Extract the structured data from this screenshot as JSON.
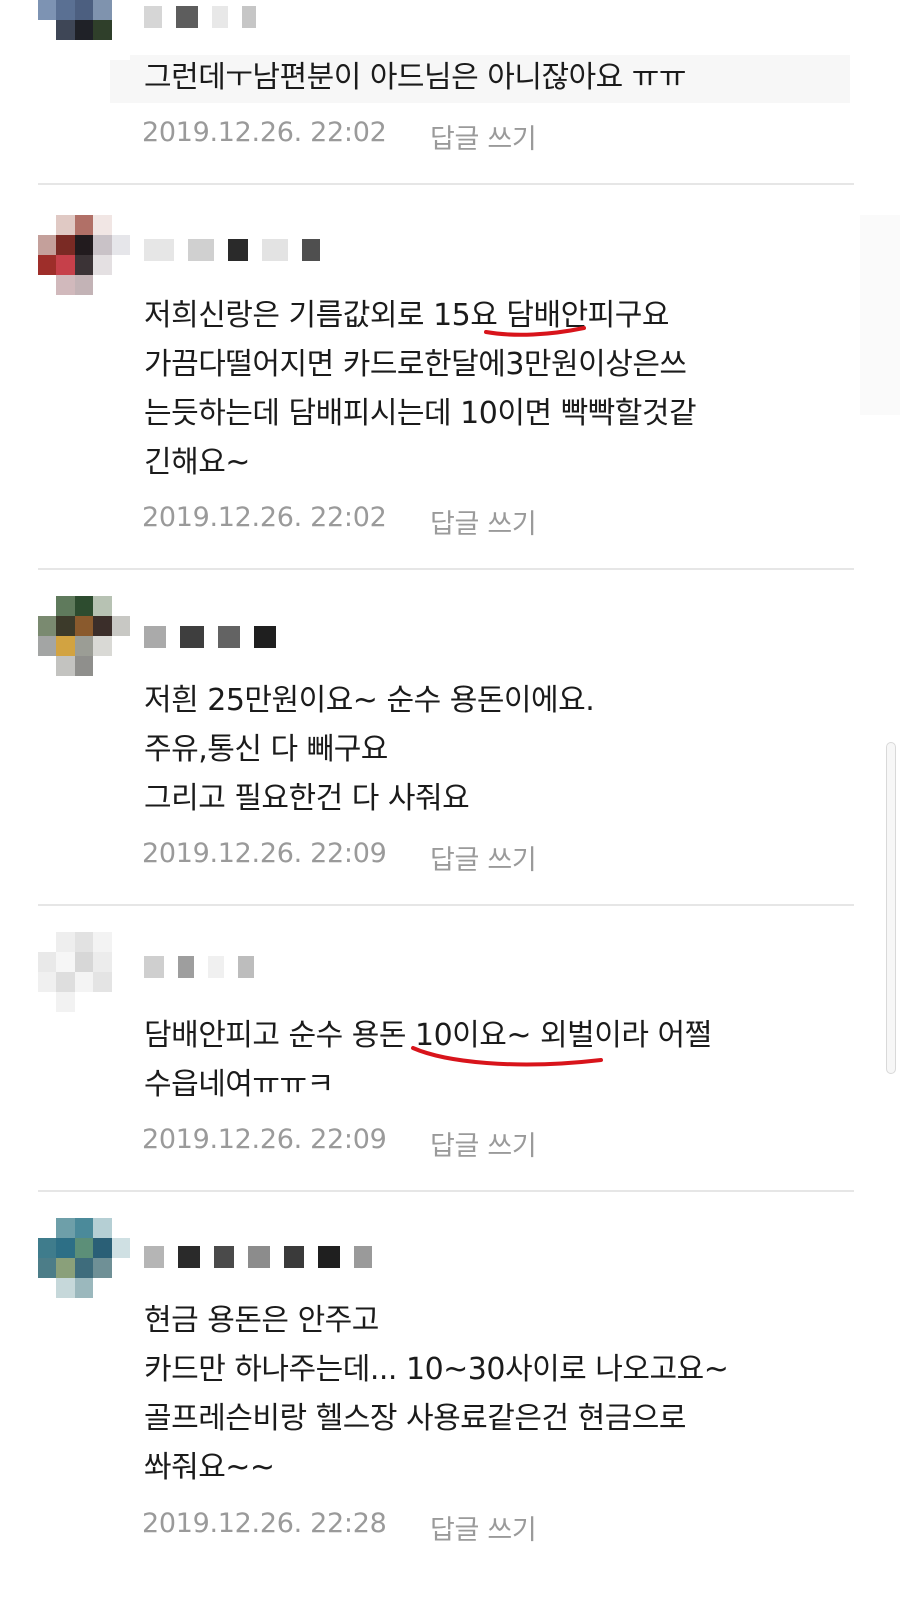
{
  "comments": [
    {
      "text_lines": [
        "그런데ㅜ남편분이 아드님은 아니잖아요 ㅠㅠ"
      ],
      "timestamp": "2019.12.26. 22:02",
      "reply": "답글 쓰기"
    },
    {
      "text_lines": [
        "저희신랑은 기름값외로 15요 담배안피구요",
        "가끔다떨어지면 카드로한달에3만원이상은쓰",
        "는듯하는데 담배피시는데 10이면 빡빡할것같",
        "긴해요~"
      ],
      "timestamp": "2019.12.26. 22:02",
      "reply": "답글 쓰기"
    },
    {
      "text_lines": [
        "저흰 25만원이요~ 순수 용돈이에요.",
        "주유,통신 다 빼구요",
        "그리고 필요한건 다 사줘요"
      ],
      "timestamp": "2019.12.26. 22:09",
      "reply": "답글 쓰기"
    },
    {
      "text_lines": [
        "담배안피고 순수 용돈 10이요~ 외벌이라 어쩔",
        "수읍네여ㅠㅠㅋ"
      ],
      "timestamp": "2019.12.26. 22:09",
      "reply": "답글 쓰기"
    },
    {
      "text_lines": [
        "현금 용돈은 안주고",
        "카드만 하나주는데... 10~30사이로 나오고요~",
        "골프레슨비랑 헬스장 사용료같은건 현금으로",
        "쏴줘요~~"
      ],
      "timestamp": "2019.12.26. 22:28",
      "reply": "답글 쓰기"
    }
  ],
  "colors": {
    "text": "#1b1b1b",
    "meta": "#9a9a9a",
    "divider": "#e6e6e6",
    "annotation": "#d8141b"
  },
  "icons": [
    "blurred-avatar",
    "blurred-nickname",
    "red-underline-annotation"
  ]
}
